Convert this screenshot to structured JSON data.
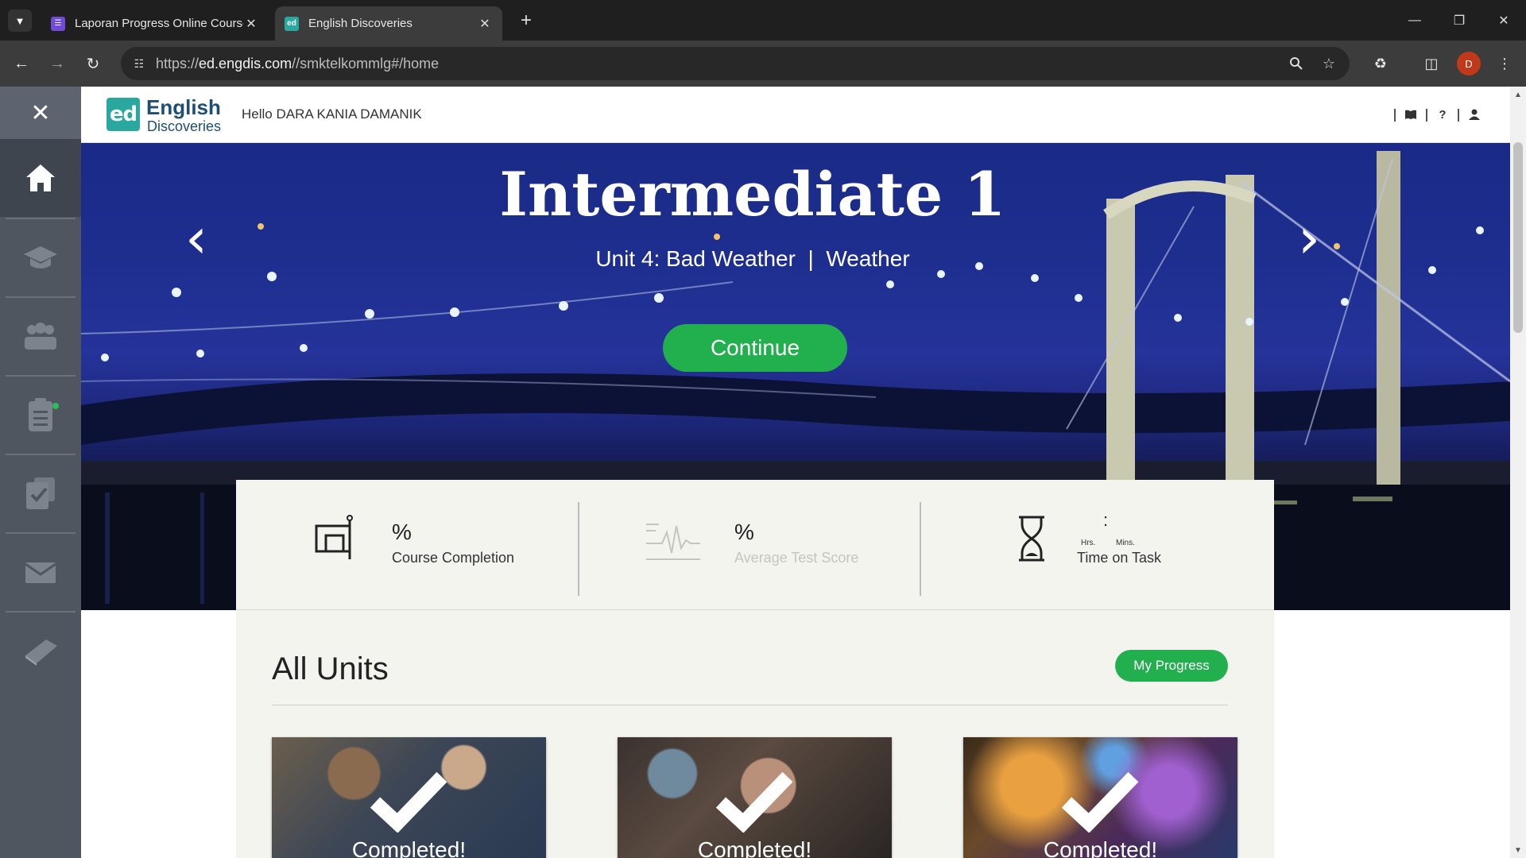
{
  "browser": {
    "tabs": [
      {
        "title": "Laporan Progress Online Course",
        "favicon_color": "#6f4bd8",
        "active": false
      },
      {
        "title": "English Discoveries",
        "favicon_color": "#2aa8a0",
        "favicon_text": "ed",
        "active": true
      }
    ],
    "url_prefix": "https://",
    "url_host": "ed.engdis.com",
    "url_path": "//smktelkommlg#/home",
    "profile_initial": "D"
  },
  "app": {
    "logo_badge": "ed",
    "logo_line1": "English",
    "logo_line2": "Discoveries",
    "greeting": "Hello DARA KANIA DAMANIK",
    "sidebar_items": [
      "home-icon",
      "courses-icon",
      "community-icon",
      "assignments-icon",
      "tests-icon",
      "messages-icon",
      "dictionary-icon"
    ],
    "header_icons": [
      "book-icon",
      "help-icon",
      "user-icon"
    ],
    "help_glyph": "?"
  },
  "hero": {
    "title": "Intermediate 1",
    "subtitle": "Unit 4: Bad Weather  |  Weather",
    "continue_label": "Continue"
  },
  "stats": {
    "completion_value": "%",
    "completion_label": "Course Completion",
    "test_value": "%",
    "test_label": "Average Test Score",
    "time_separator": ":",
    "time_hrs": "Hrs.",
    "time_mins": "Mins.",
    "time_label": "Time on Task"
  },
  "units": {
    "title": "All Units",
    "my_progress_label": "My Progress",
    "cards": [
      {
        "status": "Completed!"
      },
      {
        "status": "Completed!"
      },
      {
        "status": "Completed!"
      }
    ]
  },
  "colors": {
    "accent_green": "#22b04f",
    "sidebar": "#4f5660",
    "brand_blue": "#1d4e78"
  }
}
